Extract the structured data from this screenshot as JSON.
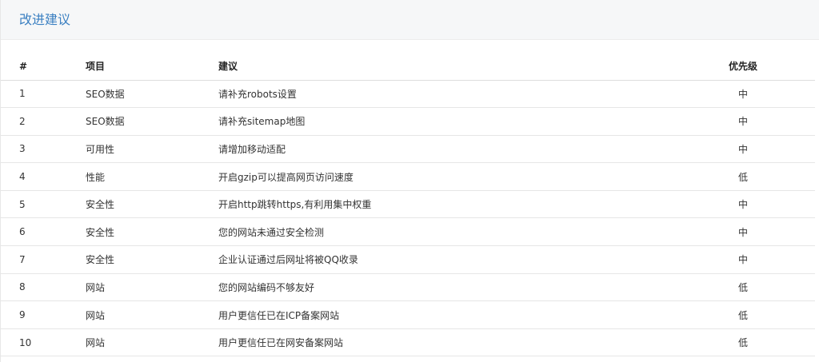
{
  "panel": {
    "title": "改进建议"
  },
  "table": {
    "headers": {
      "num": "#",
      "item": "项目",
      "suggestion": "建议",
      "priority": "优先级"
    },
    "rows": [
      {
        "num": "1",
        "item": "SEO数据",
        "suggestion": "请补充robots设置",
        "priority": "中"
      },
      {
        "num": "2",
        "item": "SEO数据",
        "suggestion": "请补充sitemap地图",
        "priority": "中"
      },
      {
        "num": "3",
        "item": "可用性",
        "suggestion": "请增加移动适配",
        "priority": "中"
      },
      {
        "num": "4",
        "item": "性能",
        "suggestion": "开启gzip可以提高网页访问速度",
        "priority": "低"
      },
      {
        "num": "5",
        "item": "安全性",
        "suggestion": "开启http跳转https,有利用集中权重",
        "priority": "中"
      },
      {
        "num": "6",
        "item": "安全性",
        "suggestion": "您的网站未通过安全检测",
        "priority": "中"
      },
      {
        "num": "7",
        "item": "安全性",
        "suggestion": "企业认证通过后网址将被QQ收录",
        "priority": "中"
      },
      {
        "num": "8",
        "item": "网站",
        "suggestion": "您的网站编码不够友好",
        "priority": "低"
      },
      {
        "num": "9",
        "item": "网站",
        "suggestion": "用户更信任已在ICP备案网站",
        "priority": "低"
      },
      {
        "num": "10",
        "item": "网站",
        "suggestion": "用户更信任已在网安备案网站",
        "priority": "低"
      }
    ]
  }
}
